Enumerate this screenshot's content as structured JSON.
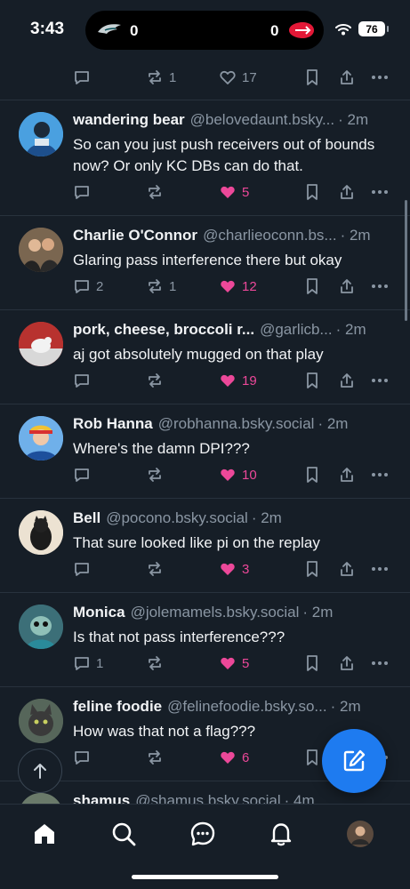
{
  "status_bar": {
    "time": "3:43",
    "score": {
      "home_score": "0",
      "away_score": "0"
    },
    "battery": "76"
  },
  "top_partial_post": {
    "replies": "",
    "reposts": "1",
    "likes": "17"
  },
  "posts": [
    {
      "author": "wandering bear",
      "handle": "@belovedaunt.bsky...",
      "time": "· 2m",
      "text": "So can you just push receivers out of bounds now? Or only KC DBs can do that.",
      "replies": "",
      "reposts": "",
      "likes": "5",
      "liked": true
    },
    {
      "author": "Charlie O'Connor",
      "handle": "@charlieoconn.bs...",
      "time": "· 2m",
      "text": "Glaring pass interference there but okay",
      "replies": "2",
      "reposts": "1",
      "likes": "12",
      "liked": true
    },
    {
      "author": "pork, cheese, broccoli r...",
      "handle": "@garlicb...",
      "time": "· 2m",
      "text": "aj got absolutely mugged on that play",
      "replies": "",
      "reposts": "",
      "likes": "19",
      "liked": true
    },
    {
      "author": "Rob Hanna",
      "handle": "@robhanna.bsky.social",
      "time": "· 2m",
      "text": "Where's the damn DPI???",
      "replies": "",
      "reposts": "",
      "likes": "10",
      "liked": true
    },
    {
      "author": "Bell",
      "handle": "@pocono.bsky.social",
      "time": "· 2m",
      "text": "That sure looked like pi on the replay",
      "replies": "",
      "reposts": "",
      "likes": "3",
      "liked": true
    },
    {
      "author": "Monica",
      "handle": "@jolemamels.bsky.social",
      "time": "· 2m",
      "text": "Is that not pass interference???",
      "replies": "1",
      "reposts": "",
      "likes": "5",
      "liked": true
    },
    {
      "author": "feline foodie",
      "handle": "@felinefoodie.bsky.so...",
      "time": "· 2m",
      "text": "How was that not a flag???",
      "replies": "",
      "reposts": "",
      "likes": "6",
      "liked": true
    },
    {
      "author": "shamus",
      "handle": "@shamus.bsky.social",
      "time": "· 4m",
      "text": "",
      "replies": "",
      "reposts": "",
      "likes": "",
      "liked": false
    }
  ],
  "tabs": [
    "home",
    "search",
    "chat",
    "notifications",
    "profile"
  ],
  "colors": {
    "background": "#161e27",
    "like": "#ec4899",
    "accent": "#1e7bf0",
    "muted": "#8a96a3"
  }
}
